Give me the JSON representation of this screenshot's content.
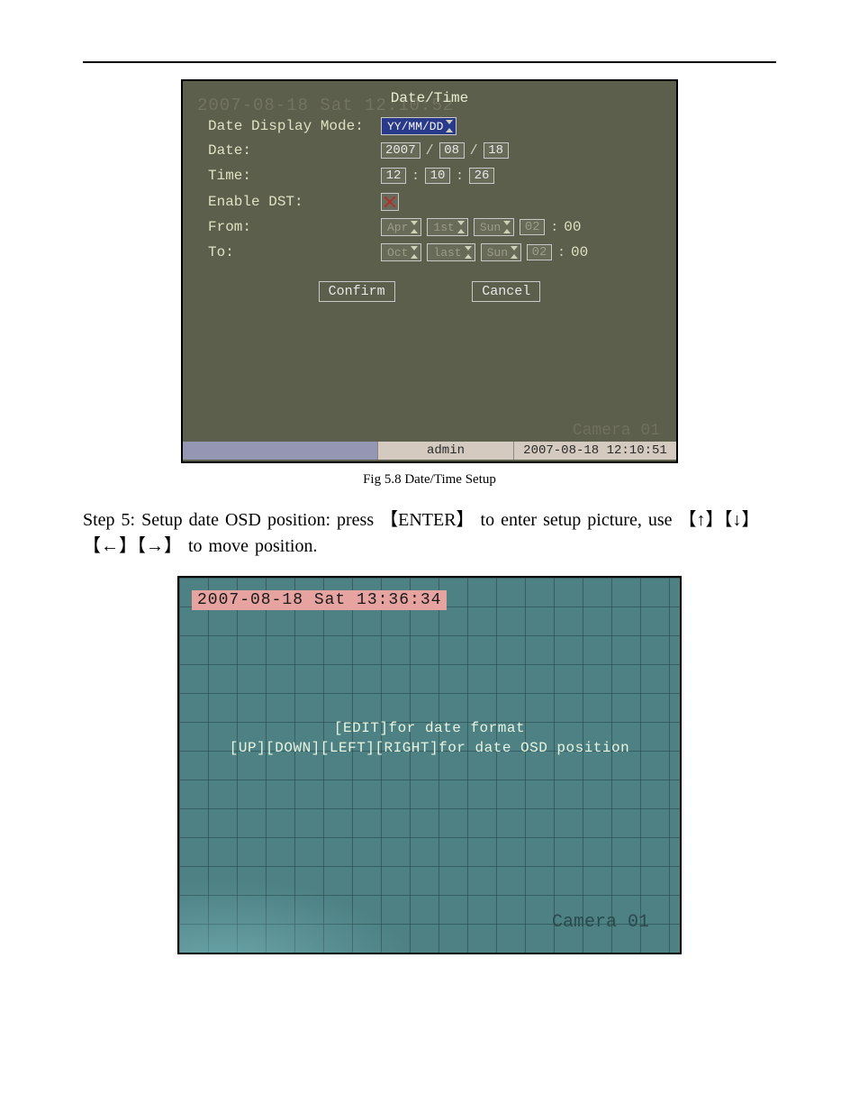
{
  "rule": true,
  "shot1": {
    "bg_stamp": "2007-08-18 Sat 12:10:52",
    "title": "Date/Time",
    "labels": {
      "mode": "Date Display Mode:",
      "date": "Date:",
      "time": "Time:",
      "dst": "Enable DST:",
      "from": "From:",
      "to": "To:"
    },
    "mode_value": "YY/MM/DD",
    "date": {
      "y": "2007",
      "m": "08",
      "d": "18"
    },
    "time": {
      "h": "12",
      "m": "10",
      "s": "26"
    },
    "from": {
      "month": "Apr",
      "week": "1st",
      "day": "Sun",
      "hh": "02",
      "mm": "00"
    },
    "to": {
      "month": "Oct",
      "week": "last",
      "day": "Sun",
      "hh": "02",
      "mm": "00"
    },
    "buttons": {
      "confirm": "Confirm",
      "cancel": "Cancel"
    },
    "camera_label": "Camera 01",
    "status_user": "admin",
    "status_time": "2007-08-18 12:10:51"
  },
  "fig1_caption": "Fig 5.8 Date/Time Setup",
  "para": {
    "seg1": "Step 5: Setup date OSD position: press ",
    "key_enter": "【ENTER】",
    "seg2": " to enter setup picture, use ",
    "key_up": "【↑】",
    "key_down": "【↓】",
    "key_left": "【←】",
    "key_right": "【→】",
    "seg3": " to move position."
  },
  "shot2": {
    "osd": "2007-08-18 Sat 13:36:34",
    "hint1": "[EDIT]for date format",
    "hint2": "[UP][DOWN][LEFT][RIGHT]for date OSD position",
    "camera_label": "Camera 01"
  }
}
